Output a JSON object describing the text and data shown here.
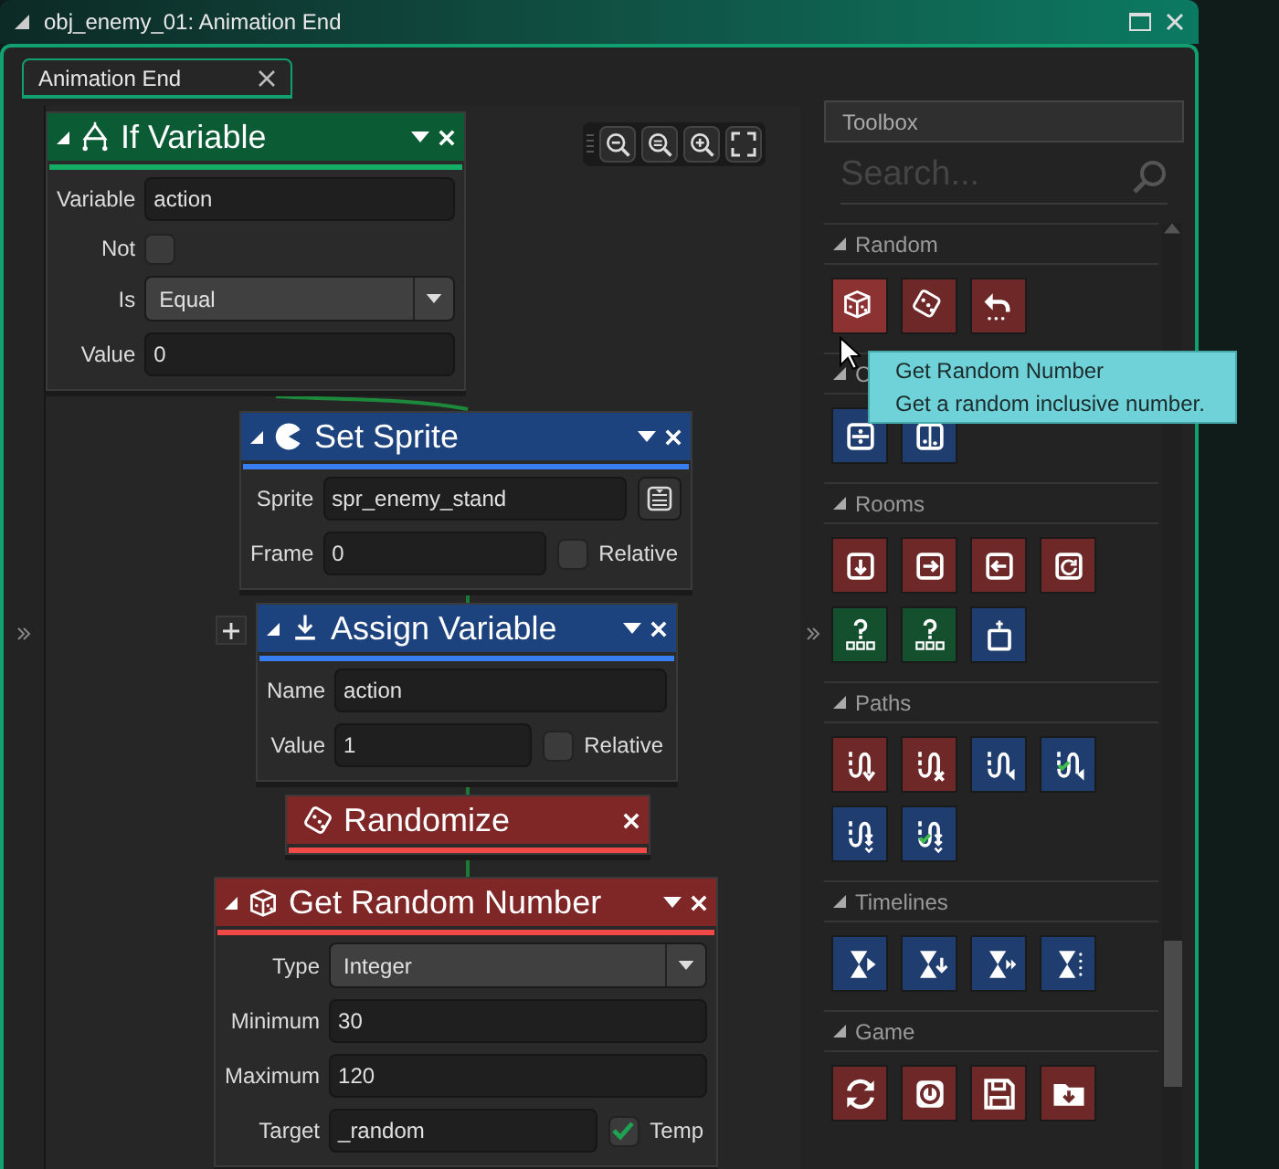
{
  "window": {
    "title": "obj_enemy_01: Animation End"
  },
  "tabs": [
    {
      "label": "Animation End",
      "selected": true
    }
  ],
  "nodes": [
    {
      "kind": "if",
      "title": "If Variable",
      "color": "#0b5b35",
      "rows": [
        {
          "kind": "text",
          "label": "Variable",
          "value": "action"
        },
        {
          "kind": "check",
          "label": "Not",
          "checked": false
        },
        {
          "kind": "select",
          "label": "Is",
          "value": "Equal"
        },
        {
          "kind": "text",
          "label": "Value",
          "value": "0"
        }
      ]
    },
    {
      "kind": "sprite",
      "title": "Set Sprite",
      "color": "#1d437f",
      "rows": [
        {
          "kind": "text_button",
          "label": "Sprite",
          "value": "spr_enemy_stand"
        },
        {
          "kind": "text_check",
          "label": "Frame",
          "value": "0",
          "check_label": "Relative",
          "checked": false
        }
      ]
    },
    {
      "kind": "assign",
      "title": "Assign Variable",
      "color": "#1d437f",
      "rows": [
        {
          "kind": "text",
          "label": "Name",
          "value": "action"
        },
        {
          "kind": "text_check",
          "label": "Value",
          "value": "1",
          "check_label": "Relative",
          "checked": false
        }
      ]
    },
    {
      "kind": "dice",
      "title": "Randomize",
      "color": "#7f2626"
    },
    {
      "kind": "cube",
      "title": "Get Random Number",
      "color": "#7f2626",
      "rows": [
        {
          "kind": "select",
          "label": "Type",
          "value": "Integer"
        },
        {
          "kind": "text",
          "label": "Minimum",
          "value": "30"
        },
        {
          "kind": "text",
          "label": "Maximum",
          "value": "120"
        },
        {
          "kind": "text_check",
          "label": "Target",
          "value": "_random",
          "check_label": "Temp",
          "checked": true
        }
      ]
    }
  ],
  "toolbox": {
    "title": "Toolbox",
    "search_placeholder": "Search...",
    "sections": [
      {
        "title": "Random",
        "tools": [
          {
            "kind": "cube",
            "color": "#8c3232"
          },
          {
            "kind": "dice",
            "color": "#6e2828"
          },
          {
            "kind": "undo",
            "color": "#6e2828"
          }
        ]
      },
      {
        "title": "C",
        "tools": [
          {
            "kind": "grid_in",
            "color": "#1f3d6e"
          },
          {
            "kind": "grid_side",
            "color": "#1f3d6e"
          }
        ]
      },
      {
        "title": "Rooms",
        "tools": [
          {
            "kind": "box_down",
            "color": "#6e2828"
          },
          {
            "kind": "box_right",
            "color": "#6e2828"
          },
          {
            "kind": "box_left",
            "color": "#6e2828"
          },
          {
            "kind": "box_restart",
            "color": "#6e2828"
          },
          {
            "kind": "question",
            "color": "#14502e"
          },
          {
            "kind": "question",
            "color": "#14502e"
          },
          {
            "kind": "screen",
            "color": "#1f3d6e"
          }
        ]
      },
      {
        "title": "Paths",
        "tools": [
          {
            "kind": "path_down",
            "color": "#6e2828"
          },
          {
            "kind": "path_x",
            "color": "#6e2828"
          },
          {
            "kind": "path_left",
            "color": "#1f3d6e"
          },
          {
            "kind": "path_check",
            "color": "#1f3d6e"
          },
          {
            "kind": "path_dots",
            "color": "#1f3d6e"
          },
          {
            "kind": "path_check_dots",
            "color": "#1f3d6e"
          }
        ]
      },
      {
        "title": "Timelines",
        "tools": [
          {
            "kind": "hour_play",
            "color": "#1f3d6e"
          },
          {
            "kind": "hour_down",
            "color": "#1f3d6e"
          },
          {
            "kind": "hour_fast",
            "color": "#1f3d6e"
          },
          {
            "kind": "hour_dots",
            "color": "#1f3d6e"
          }
        ]
      },
      {
        "title": "Game",
        "tools": [
          {
            "kind": "restart",
            "color": "#6e2828"
          },
          {
            "kind": "power",
            "color": "#6e2828"
          },
          {
            "kind": "floppy",
            "color": "#6e2828"
          },
          {
            "kind": "folder",
            "color": "#6e2828"
          }
        ]
      }
    ]
  },
  "tooltip": {
    "title": "Get Random Number",
    "text": "Get a random inclusive number."
  }
}
